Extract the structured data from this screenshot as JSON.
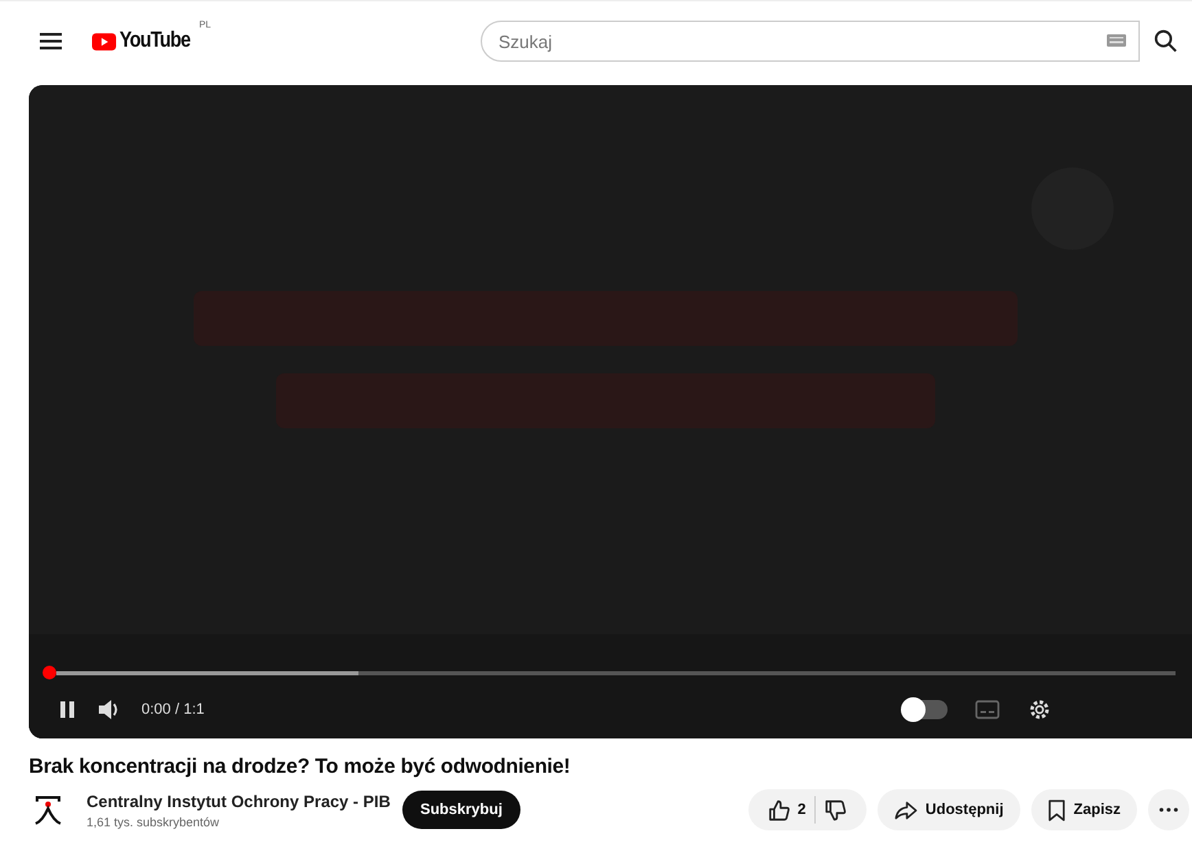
{
  "header": {
    "logo_text": "YouTube",
    "region": "PL",
    "search": {
      "placeholder": "Szukaj"
    }
  },
  "player": {
    "progress": {
      "level": 0
    },
    "buffer": {
      "level": 0.27
    },
    "playing": true,
    "time": "0:00 / 1:1",
    "autoplay": {
      "on": false
    }
  },
  "video": {
    "title": "Brak koncentracji na drodze? To może być odwodnienie!",
    "channel": "Centralny Instytut Ochrony Pracy - PIB",
    "subscribers": "1,61 tys. subskrybentów",
    "subscribe": "Subskrybuj",
    "likes": "2",
    "share": "Udostępnij",
    "save": "Zapisz"
  }
}
